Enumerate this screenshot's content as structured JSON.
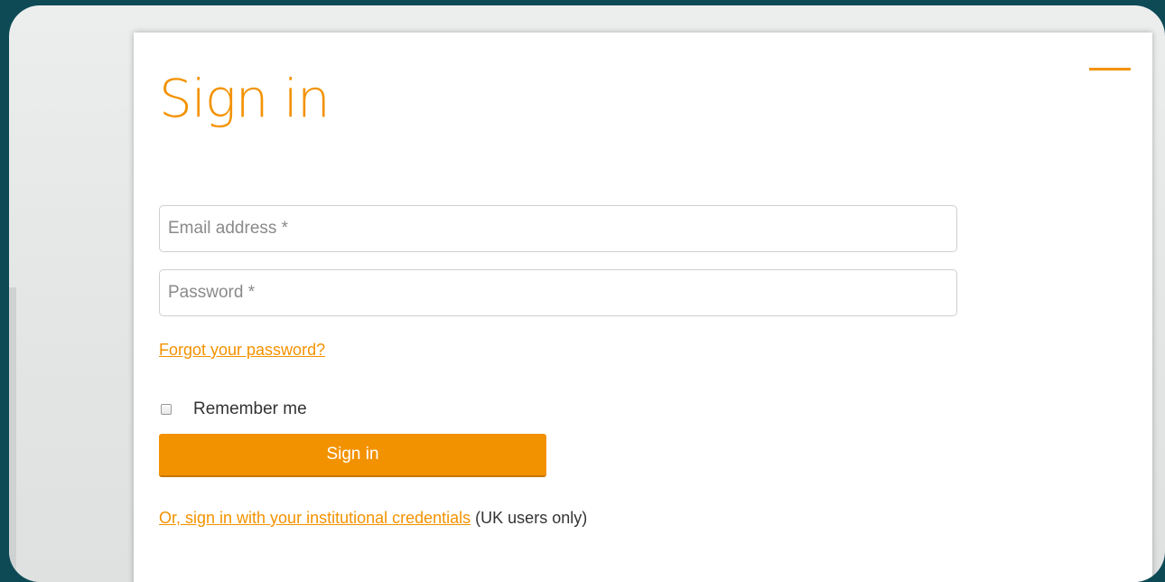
{
  "dialog": {
    "title": "Sign in",
    "email": {
      "placeholder": "Email address *",
      "value": ""
    },
    "password": {
      "placeholder": "Password *",
      "value": ""
    },
    "forgot_link": "Forgot your password?",
    "remember": {
      "label": "Remember me",
      "checked": false
    },
    "submit_label": "Sign in",
    "institutional": {
      "link_text": "Or, sign in with your institutional credentials",
      "suffix_text": " (UK users only)"
    },
    "minimize_icon": "minus-icon"
  },
  "colors": {
    "accent": "#f39200",
    "outer_background": "#0d4a56",
    "frame_background": "#e5e7e7",
    "card_background": "#ffffff",
    "text": "#333333",
    "placeholder": "#8a8a8a"
  }
}
